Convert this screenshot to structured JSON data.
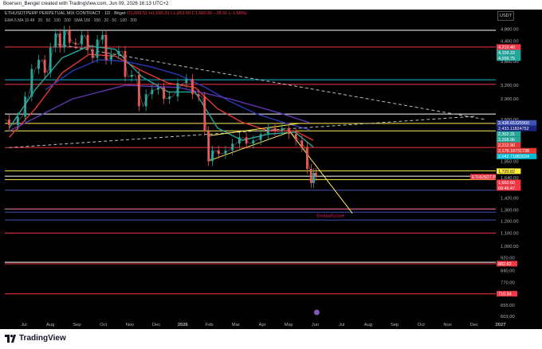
{
  "header": {
    "attribution": "Boersen_Bengel created with TradingView.com, Jun 09, 2026 16:13 UTC+2"
  },
  "legend": {
    "symbol": "ETHUSDTPERP PERPETUAL MIX CONTRACT · 1D · Bitget",
    "ohlc": "O1,669.51 H1,690.31 L1,653.00 C1,660.60 −28.31 (−1.68%)",
    "indicators": [
      "EMA 5 MA 10 48",
      "20",
      "50",
      "100",
      "200",
      "SMA 100 · 200 · 20 · 50 · 100 · 200"
    ]
  },
  "axis": {
    "currency": "USDT"
  },
  "footer": {
    "brand": "TradingView"
  },
  "colors": {
    "background": "#000000",
    "bull": "#26a69a",
    "bear": "#ef5350",
    "ema_red": "#e53935",
    "ema_teal": "#26a69a",
    "ema_blue": "#283bb3",
    "ema_purple": "#5e35b1",
    "yellow": "#ffee58",
    "pink": "#e91e63",
    "cyan": "#00bcd4"
  },
  "chart_data": {
    "type": "candlestick",
    "symbol": "ETHUSDTPERP",
    "timeframe": "1D",
    "y_scale": "log",
    "ylim": [
      600,
      5100
    ],
    "y_ticks": [
      "4,800.00",
      "4,400.00",
      "3,800.00",
      "3,200.00",
      "2,900.00",
      "2,500.00",
      "2,100.00",
      "1,850.00",
      "1,640.00",
      "1,540.00",
      "1,420.00",
      "1,300.00",
      "1,200.00",
      "1,100.00",
      "1,000.00",
      "920.00",
      "840.00",
      "770.00",
      "710.00",
      "655.00",
      "603.00"
    ],
    "x_ticks": [
      "Jul",
      "Aug",
      "Sep",
      "Oct",
      "Nov",
      "Dec",
      "2026",
      "Feb",
      "Mar",
      "Apr",
      "May",
      "Jun",
      "Jul",
      "Aug",
      "Sep",
      "Oct",
      "Nov",
      "Dec",
      "2027"
    ],
    "x_range": [
      "2025-06-15",
      "2027-01-01"
    ],
    "price_labels": [
      {
        "text": "4,219.40",
        "color": "#f23645",
        "value": 4219.4
      },
      {
        "text": "4,159.33",
        "color": "#26a69a",
        "value": 4159.33
      },
      {
        "text": "4,099.75",
        "color": "#26a69a",
        "value": 4099.75
      },
      {
        "text": "2,438.65325900",
        "color": "#3f51b5",
        "value": 2438.65
      },
      {
        "text": "2,433.11824752",
        "color": "#1a237e",
        "value": 2433.12
      },
      {
        "text": "2,302.31",
        "color": "#26a69a",
        "value": 2302.31
      },
      {
        "text": "2,268.96",
        "color": "#26a69a",
        "value": 2268.96
      },
      {
        "text": "2,212.90",
        "color": "#e53935",
        "value": 2212.9
      },
      {
        "text": "2,178.18731738",
        "color": "#e53935",
        "value": 2178.19
      },
      {
        "text": "2,042.71882034",
        "color": "#00bcd4",
        "value": 2042.72
      },
      {
        "text": "1,720.82",
        "color": "#ffeb3b",
        "value": 1720.82
      },
      {
        "text": "ETHUSDT.P",
        "color": "#f23645",
        "value": 1660.6
      },
      {
        "text": "1,660.60",
        "color": "#f23645",
        "value": 1660.6
      },
      {
        "text": "09:46:47",
        "color": "#f23645",
        "value": 1660.6
      },
      {
        "text": "882.82",
        "color": "#f23645",
        "value": 882.82
      },
      {
        "text": "710.34",
        "color": "#f23645",
        "value": 710.34
      }
    ],
    "horizontal_levels": [
      {
        "value": 4760,
        "color": "#ffffff"
      },
      {
        "value": 4219.4,
        "color": "#f23645"
      },
      {
        "value": 3330,
        "color": "#00bcd4"
      },
      {
        "value": 3220,
        "color": "#f23645"
      },
      {
        "value": 2600,
        "color": "#ffffff"
      },
      {
        "value": 2430,
        "color": "#ffee58"
      },
      {
        "value": 2302,
        "color": "#ffee58"
      },
      {
        "value": 2042,
        "color": "#f23645"
      },
      {
        "value": 1725,
        "color": "#ffee58"
      },
      {
        "value": 1660,
        "color": "#ffffff"
      },
      {
        "value": 1620,
        "color": "#ffee58"
      },
      {
        "value": 1500,
        "color": "#3f51b5"
      },
      {
        "value": 1310,
        "color": "#ff80ab"
      },
      {
        "value": 1280,
        "color": "#3f51b5"
      },
      {
        "value": 1210,
        "color": "#3f51b5"
      },
      {
        "value": 1100,
        "color": "#f23645"
      },
      {
        "value": 892,
        "color": "#ffffff"
      },
      {
        "value": 882,
        "color": "#f23645"
      },
      {
        "value": 710,
        "color": "#f23645"
      }
    ],
    "annotations": [
      {
        "text": "Einkaufszone",
        "color": "#e91e63",
        "date": "2026-06-20",
        "value": 1255
      }
    ],
    "price_path": [
      [
        "2025-06-15",
        2500
      ],
      [
        "2025-06-25",
        2400
      ],
      [
        "2025-07-05",
        2550
      ],
      [
        "2025-07-12",
        2950
      ],
      [
        "2025-07-20",
        3600
      ],
      [
        "2025-07-28",
        3850
      ],
      [
        "2025-08-03",
        3500
      ],
      [
        "2025-08-10",
        4200
      ],
      [
        "2025-08-15",
        4650
      ],
      [
        "2025-08-20",
        4200
      ],
      [
        "2025-08-25",
        4750
      ],
      [
        "2025-09-01",
        4350
      ],
      [
        "2025-09-08",
        4300
      ],
      [
        "2025-09-15",
        4600
      ],
      [
        "2025-09-22",
        4150
      ],
      [
        "2025-09-26",
        3900
      ],
      [
        "2025-10-03",
        4450
      ],
      [
        "2025-10-08",
        4600
      ],
      [
        "2025-10-11",
        3850
      ],
      [
        "2025-10-20",
        4000
      ],
      [
        "2025-10-28",
        4100
      ],
      [
        "2025-11-04",
        3400
      ],
      [
        "2025-11-12",
        3450
      ],
      [
        "2025-11-21",
        2750
      ],
      [
        "2025-11-28",
        3000
      ],
      [
        "2025-12-05",
        3100
      ],
      [
        "2025-12-12",
        3150
      ],
      [
        "2025-12-18",
        2900
      ],
      [
        "2025-12-25",
        2950
      ],
      [
        "2026-01-06",
        3250
      ],
      [
        "2026-01-14",
        3350
      ],
      [
        "2026-01-20",
        3000
      ],
      [
        "2026-01-28",
        2950
      ],
      [
        "2026-02-03",
        2300
      ],
      [
        "2026-02-06",
        1850
      ],
      [
        "2026-02-12",
        2000
      ],
      [
        "2026-02-20",
        1950
      ],
      [
        "2026-02-28",
        2000
      ],
      [
        "2026-03-08",
        2100
      ],
      [
        "2026-03-16",
        2200
      ],
      [
        "2026-03-24",
        2100
      ],
      [
        "2026-04-01",
        2150
      ],
      [
        "2026-04-10",
        2250
      ],
      [
        "2026-04-18",
        2350
      ],
      [
        "2026-04-26",
        2300
      ],
      [
        "2026-05-04",
        2350
      ],
      [
        "2026-05-12",
        2250
      ],
      [
        "2026-05-20",
        2150
      ],
      [
        "2026-05-26",
        2050
      ],
      [
        "2026-06-01",
        1750
      ],
      [
        "2026-06-04",
        1580
      ],
      [
        "2026-06-07",
        1700
      ],
      [
        "2026-06-09",
        1660.6
      ]
    ],
    "trendlines": [
      {
        "color": "#bdbdbd",
        "dash": true,
        "points": [
          [
            "2025-08-15",
            4300
          ],
          [
            "2026-12-20",
            2500
          ]
        ]
      },
      {
        "color": "#bdbdbd",
        "dash": true,
        "points": [
          [
            "2025-06-20",
            2040
          ],
          [
            "2026-12-10",
            2560
          ]
        ]
      },
      {
        "color": "#ffee58",
        "dash": false,
        "points": [
          [
            "2026-02-06",
            1860
          ],
          [
            "2026-05-06",
            2270
          ]
        ]
      },
      {
        "color": "#ffee58",
        "dash": false,
        "points": [
          [
            "2026-02-03",
            2220
          ],
          [
            "2026-05-20",
            2430
          ]
        ]
      },
      {
        "color": "#ffee58",
        "dash": false,
        "points": [
          [
            "2026-05-08",
            2310
          ],
          [
            "2026-07-20",
            1270
          ]
        ]
      }
    ],
    "moving_averages": [
      {
        "color": "#e53935",
        "points": [
          [
            "2025-06-20",
            2200
          ],
          [
            "2025-07-20",
            2700
          ],
          [
            "2025-08-20",
            3500
          ],
          [
            "2025-09-20",
            4000
          ],
          [
            "2025-10-20",
            3950
          ],
          [
            "2025-11-20",
            3550
          ],
          [
            "2025-12-20",
            3250
          ],
          [
            "2026-01-20",
            3150
          ],
          [
            "2026-02-15",
            2700
          ],
          [
            "2026-03-15",
            2450
          ],
          [
            "2026-04-15",
            2300
          ],
          [
            "2026-05-15",
            2300
          ],
          [
            "2026-06-05",
            2150
          ]
        ]
      },
      {
        "color": "#26a69a",
        "points": [
          [
            "2025-06-20",
            2350
          ],
          [
            "2025-07-20",
            3100
          ],
          [
            "2025-08-20",
            3900
          ],
          [
            "2025-09-20",
            4250
          ],
          [
            "2025-10-20",
            4150
          ],
          [
            "2025-11-20",
            3400
          ],
          [
            "2025-12-20",
            3050
          ],
          [
            "2026-01-20",
            3050
          ],
          [
            "2026-02-15",
            2350
          ],
          [
            "2026-03-15",
            2150
          ],
          [
            "2026-04-15",
            2250
          ],
          [
            "2026-05-15",
            2280
          ],
          [
            "2026-06-05",
            2050
          ]
        ]
      },
      {
        "color": "#283bb3",
        "points": [
          [
            "2025-08-01",
            3100
          ],
          [
            "2025-09-01",
            3550
          ],
          [
            "2025-10-01",
            3850
          ],
          [
            "2025-11-01",
            3800
          ],
          [
            "2025-12-01",
            3650
          ],
          [
            "2026-01-01",
            3450
          ],
          [
            "2026-02-01",
            3150
          ],
          [
            "2026-03-01",
            2850
          ],
          [
            "2026-04-01",
            2600
          ],
          [
            "2026-05-01",
            2450
          ],
          [
            "2026-06-01",
            2320
          ]
        ]
      },
      {
        "color": "#5e35b1",
        "points": [
          [
            "2025-06-20",
            2300
          ],
          [
            "2025-09-01",
            2900
          ],
          [
            "2025-11-01",
            3200
          ],
          [
            "2026-01-01",
            3150
          ],
          [
            "2026-03-01",
            2900
          ],
          [
            "2026-05-01",
            2600
          ],
          [
            "2026-06-01",
            2440
          ]
        ]
      }
    ]
  }
}
